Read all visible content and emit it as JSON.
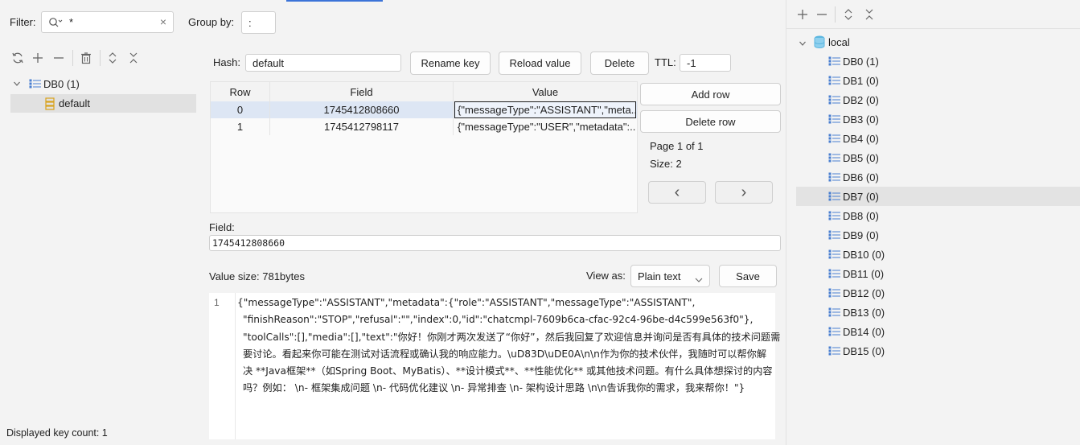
{
  "filter": {
    "label": "Filter:",
    "value": "*",
    "clear_glyph": "×"
  },
  "group_by": {
    "label": "Group by:",
    "value": ":"
  },
  "left_tree": {
    "db": {
      "label": "DB0 (1)"
    },
    "key": {
      "label": "default"
    }
  },
  "status": {
    "displayed_key_count": "Displayed key count: 1"
  },
  "hash": {
    "label": "Hash:",
    "value": "default",
    "rename_label": "Rename key",
    "reload_label": "Reload value",
    "delete_label": "Delete",
    "ttl_label": "TTL:",
    "ttl_value": "-1"
  },
  "table": {
    "headers": [
      "Row",
      "Field",
      "Value"
    ],
    "rows": [
      {
        "row": "0",
        "field": "1745412808660",
        "value": "{\"messageType\":\"ASSISTANT\",\"meta..."
      },
      {
        "row": "1",
        "field": "1745412798117",
        "value": "{\"messageType\":\"USER\",\"metadata\":..."
      }
    ]
  },
  "row_actions": {
    "add_label": "Add row",
    "delete_label": "Delete row",
    "page_text": "Page 1 of 1",
    "size_text": "Size: 2",
    "prev_glyph": "‹",
    "next_glyph": "›"
  },
  "field_editor": {
    "label": "Field:",
    "value": "1745412808660"
  },
  "value_editor": {
    "size_text": "Value size: 781bytes",
    "view_as_label": "View as:",
    "view_as_value": "Plain text",
    "save_label": "Save",
    "line_number": "1",
    "lines": [
      "{\"messageType\":\"ASSISTANT\",\"metadata\":{\"role\":\"ASSISTANT\",\"messageType\":\"ASSISTANT\",",
      "\"finishReason\":\"STOP\",\"refusal\":\"\",\"index\":0,\"id\":\"chatcmpl-7609b6ca-cfac-92c4-96be-d4c599e563f0\"},",
      "\"toolCalls\":[],\"media\":[],\"text\":\"你好！你刚才两次发送了“你好”，然后我回复了欢迎信息并询问是否有具体的技术问题需",
      "要讨论。看起来你可能在测试对话流程或确认我的响应能力。\\uD83D\\uDE0A\\n\\n作为你的技术伙伴，我随时可以帮你解",
      "决 **Java框架**（如Spring Boot、MyBatis）、**设计模式**、**性能优化** 或其他技术问题。有什么具体想探讨的内容",
      "吗？例如：  \\n- 框架集成问题  \\n- 代码优化建议  \\n- 异常排查  \\n- 架构设计思路  \\n\\n告诉我你的需求，我来帮你！\"}"
    ]
  },
  "right_tree": {
    "connection": {
      "label": "local"
    },
    "databases": [
      "DB0 (1)",
      "DB1 (0)",
      "DB2 (0)",
      "DB3 (0)",
      "DB4 (0)",
      "DB5 (0)",
      "DB6 (0)",
      "DB7 (0)",
      "DB8 (0)",
      "DB9 (0)",
      "DB10 (0)",
      "DB11 (0)",
      "DB12 (0)",
      "DB13 (0)",
      "DB14 (0)",
      "DB15 (0)"
    ],
    "selected": "DB7 (0)"
  },
  "colors": {
    "accent": "#3b73d8",
    "selection": "#dde6f4",
    "db_icon": "#4a7fd0",
    "key_icon": "#d9a21b"
  }
}
